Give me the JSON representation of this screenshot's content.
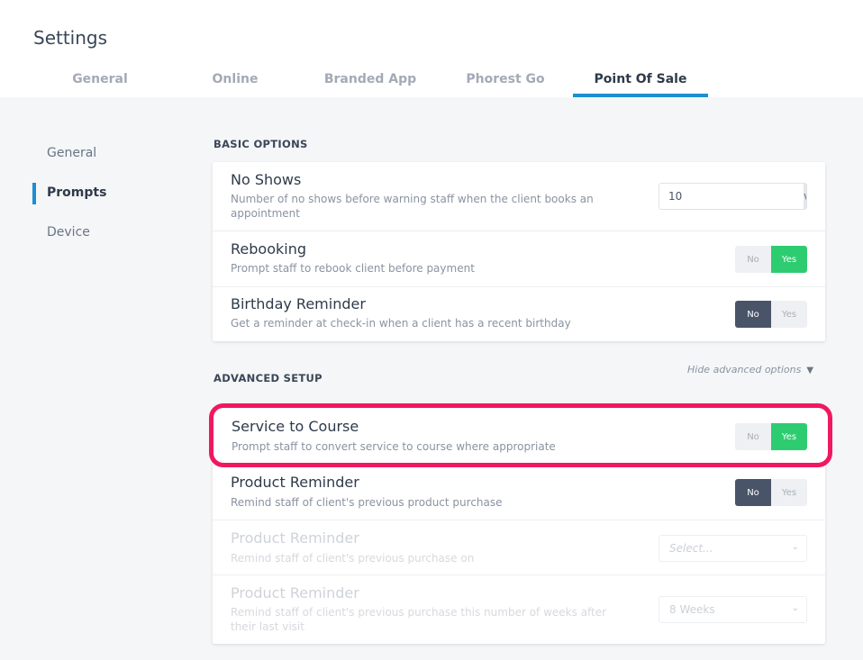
{
  "header": {
    "title": "Settings",
    "tabs": [
      {
        "label": "General"
      },
      {
        "label": "Online"
      },
      {
        "label": "Branded App"
      },
      {
        "label": "Phorest Go"
      },
      {
        "label": "Point Of Sale"
      }
    ],
    "active_tab": "Point Of Sale"
  },
  "sidebar": {
    "items": [
      {
        "label": "General"
      },
      {
        "label": "Prompts"
      },
      {
        "label": "Device"
      }
    ],
    "active_item": "Prompts"
  },
  "basic": {
    "section_title": "BASIC OPTIONS",
    "no_shows": {
      "title": "No Shows",
      "desc": "Number of no shows before warning staff when the client books an appointment",
      "value": "10",
      "suffix": "visits"
    },
    "rebooking": {
      "title": "Rebooking",
      "desc": "Prompt staff to rebook client before payment",
      "no": "No",
      "yes": "Yes",
      "selected": "Yes"
    },
    "birthday": {
      "title": "Birthday Reminder",
      "desc": "Get a reminder at check-in when a client has a recent birthday",
      "no": "No",
      "yes": "Yes",
      "selected": "No"
    }
  },
  "advanced": {
    "section_title": "ADVANCED SETUP",
    "toggle_label": "Hide advanced options",
    "service_to_course": {
      "title": "Service to Course",
      "desc": "Prompt staff to convert service to course where appropriate",
      "no": "No",
      "yes": "Yes",
      "selected": "Yes"
    },
    "product_reminder": {
      "title": "Product Reminder",
      "desc": "Remind staff of client's previous product purchase",
      "no": "No",
      "yes": "Yes",
      "selected": "No"
    },
    "product_reminder_on": {
      "title": "Product Reminder",
      "desc": "Remind staff of client's previous purchase on",
      "placeholder": "Select..."
    },
    "product_reminder_weeks": {
      "title": "Product Reminder",
      "desc": "Remind staff of client's previous purchase this number of weeks after their last visit",
      "value": "8 Weeks"
    }
  },
  "colors": {
    "accent": "#1b8fd1",
    "yes_active": "#2ecc71",
    "no_active": "#4a5468",
    "highlight": "#f0185f"
  }
}
